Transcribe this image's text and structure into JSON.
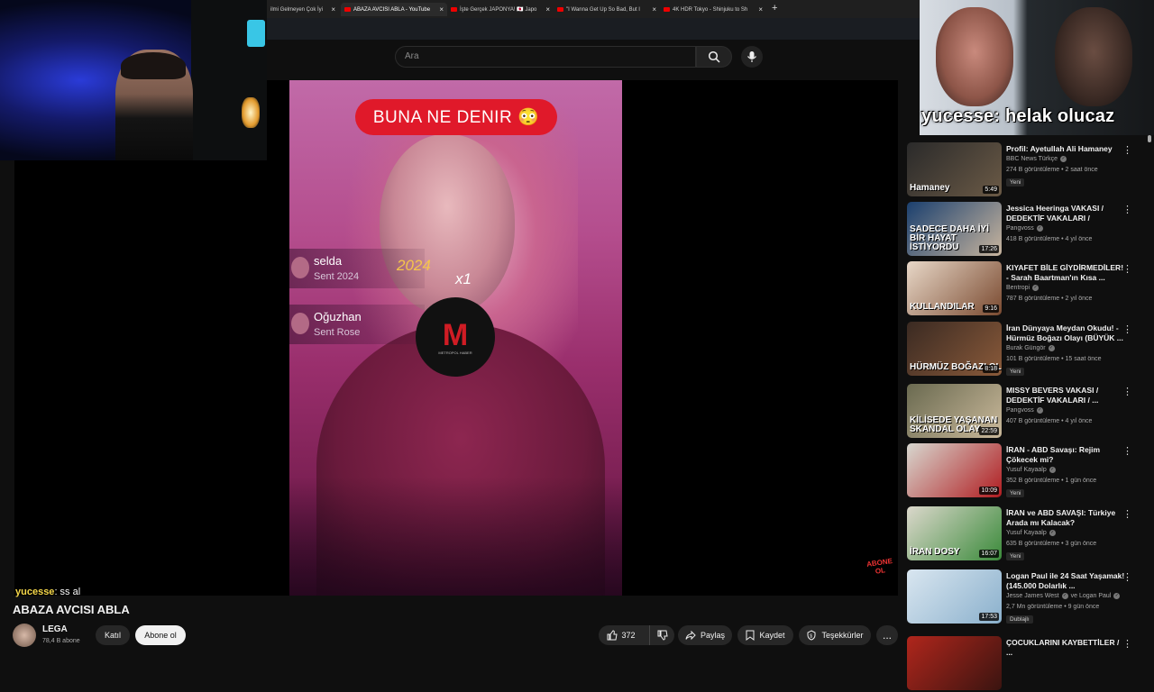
{
  "browser": {
    "tabs": [
      {
        "title": "ilmi Gelmeyen Çok İyi",
        "active": false
      },
      {
        "title": "ABAZA AVCISI ABLA - YouTube",
        "active": true
      },
      {
        "title": "İşte Gerçek JAPONYA! 🇯🇵 Japo",
        "active": false
      },
      {
        "title": "\"I Wanna Get Up So Bad, But I",
        "active": false
      },
      {
        "title": "4K HDR Tokyo - Shinjuku to Sh",
        "active": false
      }
    ],
    "new_tab": "+"
  },
  "header": {
    "search_placeholder": "Ara"
  },
  "video": {
    "overlay_banner": "BUNA NE DENIR 😳",
    "gifts": [
      {
        "name": "selda",
        "sub": "Sent 2024"
      },
      {
        "name": "Oğuzhan",
        "sub": "Sent Rose"
      }
    ],
    "gift_year": "2024",
    "gift_count": "x1",
    "logo_letter": "M",
    "logo_text": "METROPOL HABER",
    "corner_text": "ABONE OL"
  },
  "stream": {
    "overlay_text": "yucesse: helak olucaz",
    "chat_user": "yucesse",
    "chat_msg": ": ss al"
  },
  "meta": {
    "title": "ABAZA AVCISI ABLA",
    "channel": "LEGA",
    "subscribers": "78,4 B abone",
    "join_label": "Katıl",
    "subscribe_label": "Abone ol",
    "likes": "372",
    "share_label": "Paylaş",
    "save_label": "Kaydet",
    "thanks_label": "Teşekkürler",
    "more_label": "..."
  },
  "recommendations": [
    {
      "title": "Profil: Ayetullah Ali Hamaney",
      "channel": "BBC News Türkçe",
      "verified": true,
      "meta": "274 B görüntüleme • 2 saat önce",
      "new": "Yeni",
      "duration": "5:49",
      "thumb_caption": "Hamaney",
      "colors": [
        "#2a2a2a",
        "#6b5a46"
      ]
    },
    {
      "title": "Jessica Heeringa VAKASI / DEDEKTİF VAKALARI /",
      "channel": "Pangvoss",
      "verified": true,
      "meta": "418 B görüntüleme • 4 yıl önce",
      "new": "",
      "duration": "17:26",
      "thumb_caption": "SADECE DAHA İYİ BİR HAYAT İSTİYORDU",
      "colors": [
        "#1a3f6e",
        "#c8b59e"
      ]
    },
    {
      "title": "KIYAFET BİLE GİYDİRMEDİLER! - Sarah Baartman'ın Kısa ...",
      "channel": "Bentropi",
      "verified": true,
      "meta": "787 B görüntüleme • 2 yıl önce",
      "new": "",
      "duration": "9:16",
      "thumb_caption": "KULLANDILAR",
      "colors": [
        "#e8d8c8",
        "#7a4a30"
      ]
    },
    {
      "title": "İran Dünyaya Meydan Okudu! - Hürmüz Boğazı Olayı (BÜYÜK ...",
      "channel": "Burak Güngör",
      "verified": true,
      "meta": "101 B görüntüleme • 15 saat önce",
      "new": "Yeni",
      "duration": "8:18",
      "thumb_caption": "HÜRMÜZ BOĞAZI OL",
      "colors": [
        "#3a2a22",
        "#8a5a3a"
      ]
    },
    {
      "title": "MISSY BEVERS VAKASI / DEDEKTİF VAKALARI / ...",
      "channel": "Pangvoss",
      "verified": true,
      "meta": "407 B görüntüleme • 4 yıl önce",
      "new": "",
      "duration": "22:59",
      "thumb_caption": "KİLİSEDE YAŞANAN SKANDAL OLAY",
      "colors": [
        "#6a6a50",
        "#c9b89a"
      ]
    },
    {
      "title": "İRAN - ABD Savaşı: Rejim Çökecek mi?",
      "channel": "Yusuf Kayaalp",
      "verified": true,
      "meta": "352 B görüntüleme • 1 gün önce",
      "new": "Yeni",
      "duration": "10:09",
      "thumb_caption": "",
      "colors": [
        "#d8d8d0",
        "#b01c20"
      ]
    },
    {
      "title": "İRAN ve ABD SAVAŞI: Türkiye Arada mı Kalacak?",
      "channel": "Yusuf Kayaalp",
      "verified": true,
      "meta": "635 B görüntüleme • 3 gün önce",
      "new": "Yeni",
      "duration": "16:07",
      "thumb_caption": "İRAN DOSY",
      "colors": [
        "#dcd8cc",
        "#3a8a3a"
      ]
    },
    {
      "title": "Logan Paul ile 24 Saat Yaşamak! (145.000 Dolarlık ...",
      "channel": "Jesse James West",
      "verified": true,
      "channel2": "ve Logan Paul",
      "meta": "2,7 Mn görüntüleme • 9 gün önce",
      "new": "Dublajlı",
      "duration": "17:53",
      "thumb_caption": "",
      "colors": [
        "#d9e6f0",
        "#8ab0cc"
      ]
    },
    {
      "title": "ÇOCUKLARINI KAYBETTİLER / ...",
      "channel": "",
      "verified": false,
      "meta": "",
      "new": "",
      "duration": "",
      "thumb_caption": "",
      "colors": [
        "#b0261c",
        "#3a1410"
      ]
    }
  ]
}
